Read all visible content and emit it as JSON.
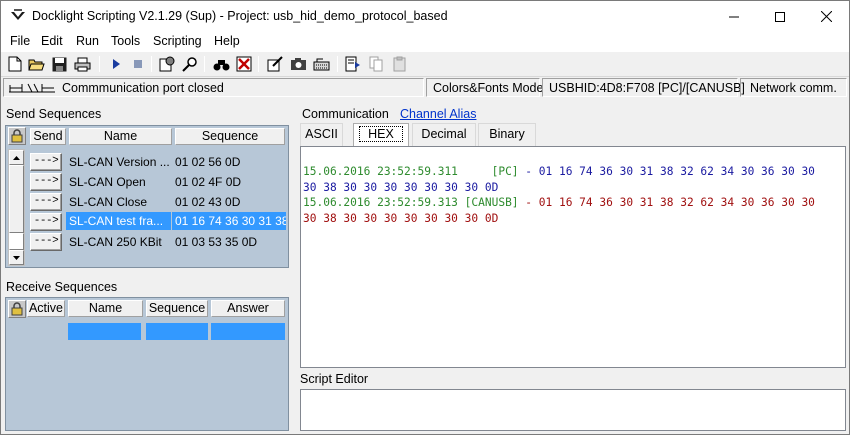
{
  "window": {
    "title": "Docklight Scripting V2.1.29 (Sup) - Project: usb_hid_demo_protocol_based"
  },
  "menu": [
    "File",
    "Edit",
    "Run",
    "Tools",
    "Scripting",
    "Help"
  ],
  "toolbar": {
    "icons": [
      "new-file-icon",
      "open-folder-icon",
      "save-icon",
      "print-icon",
      "run-icon",
      "stop-icon",
      "project-settings-icon",
      "find-icon",
      "filter-icon",
      "clear-icon",
      "edit-icon",
      "snapshot-icon",
      "keyboard-icon",
      "script-run-icon",
      "copy-icon",
      "paste-icon"
    ]
  },
  "status": {
    "port": "Commmunication port closed",
    "mode": "Colors&Fonts Mode",
    "device": "USBHID:4D8:F708 [PC]/[CANUSB]",
    "network": "Network comm."
  },
  "send": {
    "label": "Send Sequences",
    "headers": {
      "send": "Send",
      "name": "Name",
      "sequence": "Sequence"
    },
    "button_label": "--->",
    "rows": [
      {
        "name": "SL-CAN Version ...",
        "sequence": "01 02 56 0D",
        "selected": false
      },
      {
        "name": "SL-CAN Open",
        "sequence": "01 02 4F 0D",
        "selected": false
      },
      {
        "name": "SL-CAN Close",
        "sequence": "01 02 43 0D",
        "selected": false
      },
      {
        "name": "SL-CAN test fra...",
        "sequence": "01 16 74 36 30 31 38",
        "selected": true
      },
      {
        "name": "SL-CAN 250 KBit",
        "sequence": "01 03 53 35 0D",
        "selected": false
      }
    ]
  },
  "receive": {
    "label": "Receive Sequences",
    "headers": {
      "active": "Active",
      "name": "Name",
      "sequence": "Sequence",
      "answer": "Answer"
    }
  },
  "communication": {
    "label": "Communication",
    "alias_link": "Channel Alias",
    "tabs": [
      {
        "label": "ASCII",
        "active": false
      },
      {
        "label": "HEX",
        "active": true
      },
      {
        "label": "Decimal",
        "active": false
      },
      {
        "label": "Binary",
        "active": false
      }
    ],
    "log": [
      {
        "time": "15.06.2016 23:52:59.311",
        "channel": "     [PC]",
        "sep": " - ",
        "data": "01 16 74 36 30 31 38 32 62 34 30 36 30 30",
        "cont": "30 38 30 30 30 30 30 30 30 0D",
        "color": "blue"
      },
      {
        "time": "15.06.2016 23:52:59.313",
        "channel": " [CANUSB]",
        "sep": " - ",
        "data": "01 16 74 36 30 31 38 32 62 34 30 36 30 30",
        "cont": "30 38 30 30 30 30 30 30 30 0D",
        "color": "red"
      }
    ]
  },
  "script": {
    "label": "Script Editor"
  },
  "colors": {
    "grid_bg": "#b7c7d7",
    "selection": "#3399ff",
    "timestamp": "#2e8b2e",
    "pc_data": "#1a1aa0",
    "canusb_data": "#a01010"
  }
}
